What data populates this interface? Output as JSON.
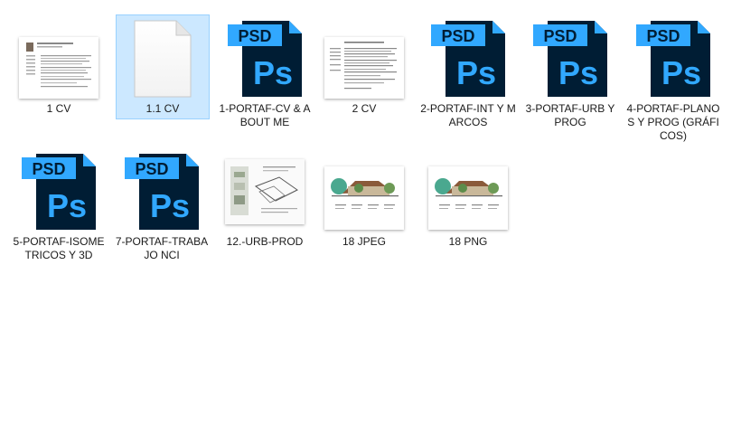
{
  "colors": {
    "psd_dark": "#001d34",
    "psd_blue": "#31a8ff",
    "selection_bg": "#cce8ff",
    "selection_border": "#99d1ff"
  },
  "psd_badge": "PSD",
  "ps_logo": "Ps",
  "files": [
    {
      "label": "1 CV",
      "kind": "cv-image"
    },
    {
      "label": "1.1 CV",
      "kind": "blank-document",
      "selected": true
    },
    {
      "label": "1-PORTAF-CV & ABOUT ME",
      "kind": "psd"
    },
    {
      "label": "2 CV",
      "kind": "text-document"
    },
    {
      "label": "2-PORTAF-INT Y MARCOS",
      "kind": "psd"
    },
    {
      "label": "3-PORTAF-URB Y PROG",
      "kind": "psd"
    },
    {
      "label": "4-PORTAF-PLANOS Y PROG (GRÁFICOS)",
      "kind": "psd"
    },
    {
      "label": "5-PORTAF-ISOMETRICOS Y 3D",
      "kind": "psd"
    },
    {
      "label": "7-PORTAF-TRABAJO NCI",
      "kind": "psd"
    },
    {
      "label": "12.-URB-PROD",
      "kind": "plan-image"
    },
    {
      "label": "18 JPEG",
      "kind": "elevation-image"
    },
    {
      "label": "18 PNG",
      "kind": "elevation-image"
    }
  ]
}
